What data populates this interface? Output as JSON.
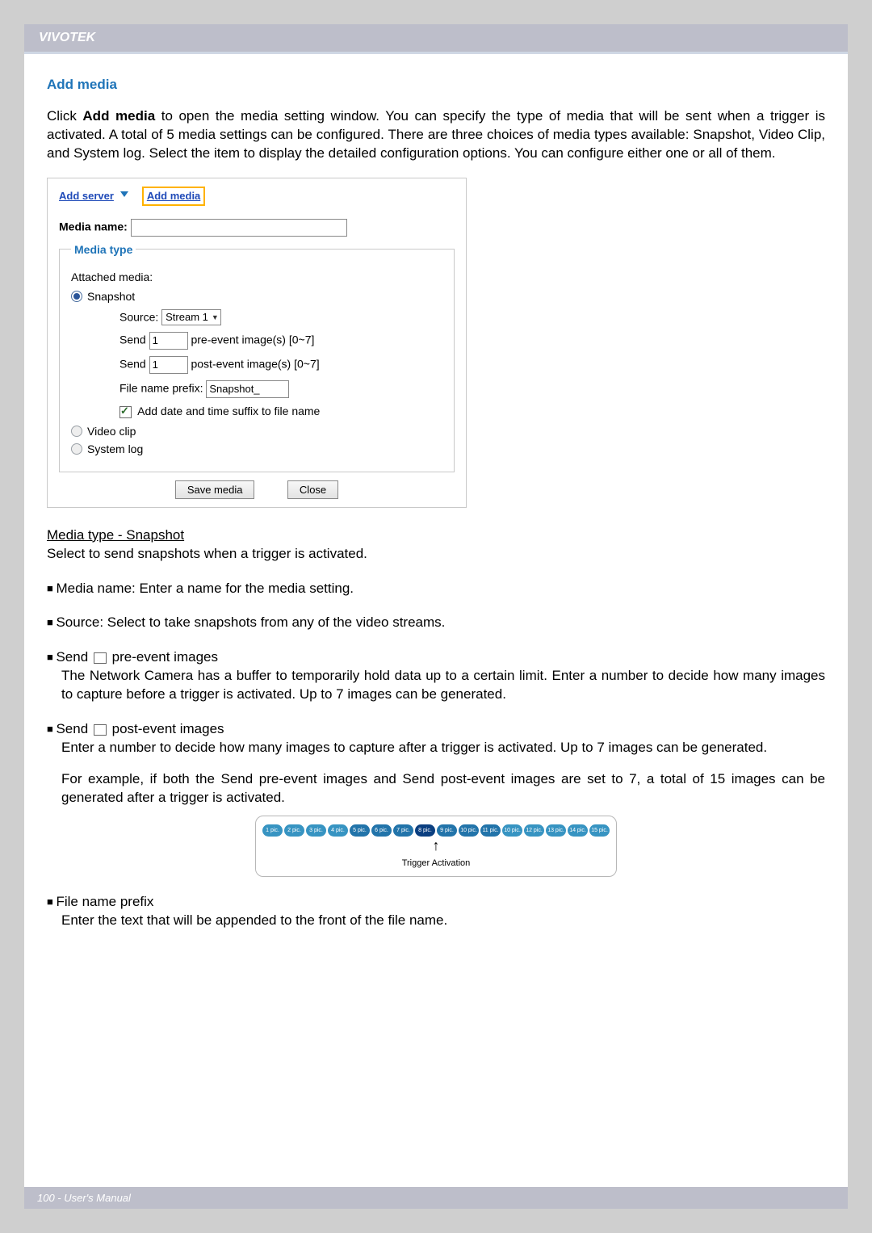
{
  "header": {
    "brand": "VIVOTEK"
  },
  "section": {
    "title": "Add media"
  },
  "intro": {
    "prefix": "Click ",
    "bold": "Add media",
    "rest": " to open the media setting window. You can specify the type of media that will be sent when a trigger is activated. A total of 5 media settings can be configured. There are three choices of media types available: Snapshot, Video Clip, and System log. Select the item to display the detailed configuration options. You can configure either one or all of them."
  },
  "dialog": {
    "links": {
      "add_server": "Add server",
      "add_media": "Add media"
    },
    "media_name_label": "Media name:",
    "media_name_value": "",
    "legend": "Media type",
    "attached_label": "Attached media:",
    "radios": {
      "snapshot": "Snapshot",
      "video_clip": "Video clip",
      "system_log": "System log"
    },
    "snapshot_opts": {
      "source_label": "Source:",
      "source_value": "Stream 1",
      "send_label": "Send",
      "pre_value": "1",
      "pre_suffix": "pre-event image(s) [0~7]",
      "post_value": "1",
      "post_suffix": "post-event image(s) [0~7]",
      "prefix_label": "File name prefix:",
      "prefix_value": "Snapshot_",
      "suffix_cb_label": "Add date and time suffix to file name"
    },
    "buttons": {
      "save": "Save media",
      "close": "Close"
    }
  },
  "explain": {
    "subhead": "Media type - Snapshot",
    "sub_para": "Select to send snapshots when a trigger is activated.",
    "b1": "Media name: Enter a name for the media setting.",
    "b2": "Source: Select to take snapshots from any of the video streams.",
    "b3_lead": "Send ",
    "b3_after": " pre-event images",
    "b3_body": "The Network Camera has a buffer to temporarily hold data up to a certain limit. Enter a number to decide how many images to capture before a trigger is activated. Up to 7 images can be generated.",
    "b4_lead": "Send ",
    "b4_after": " post-event images",
    "b4_body1": "Enter a number to decide how many images to capture after a trigger is activated. Up to 7 images can be generated.",
    "b4_body2": "For example, if both the Send pre-event images and Send post-event images are set to 7, a total of 15 images can be generated after a trigger is activated.",
    "b5_lead": "File name prefix",
    "b5_body": "Enter the text that will be appended to the front of the file name."
  },
  "trigger_fig": {
    "pills": [
      "1 pic.",
      "2 pic.",
      "3 pic.",
      "4 pic.",
      "5 pic.",
      "6 pic.",
      "7 pic.",
      "8 pic.",
      "9 pic.",
      "10 pic.",
      "11 pic.",
      "10 pic.",
      "12 pic.",
      "13 pic.",
      "14 pic.",
      "15 pic."
    ],
    "caption": "Trigger Activation"
  },
  "footer": {
    "text": "100 - User's Manual"
  }
}
